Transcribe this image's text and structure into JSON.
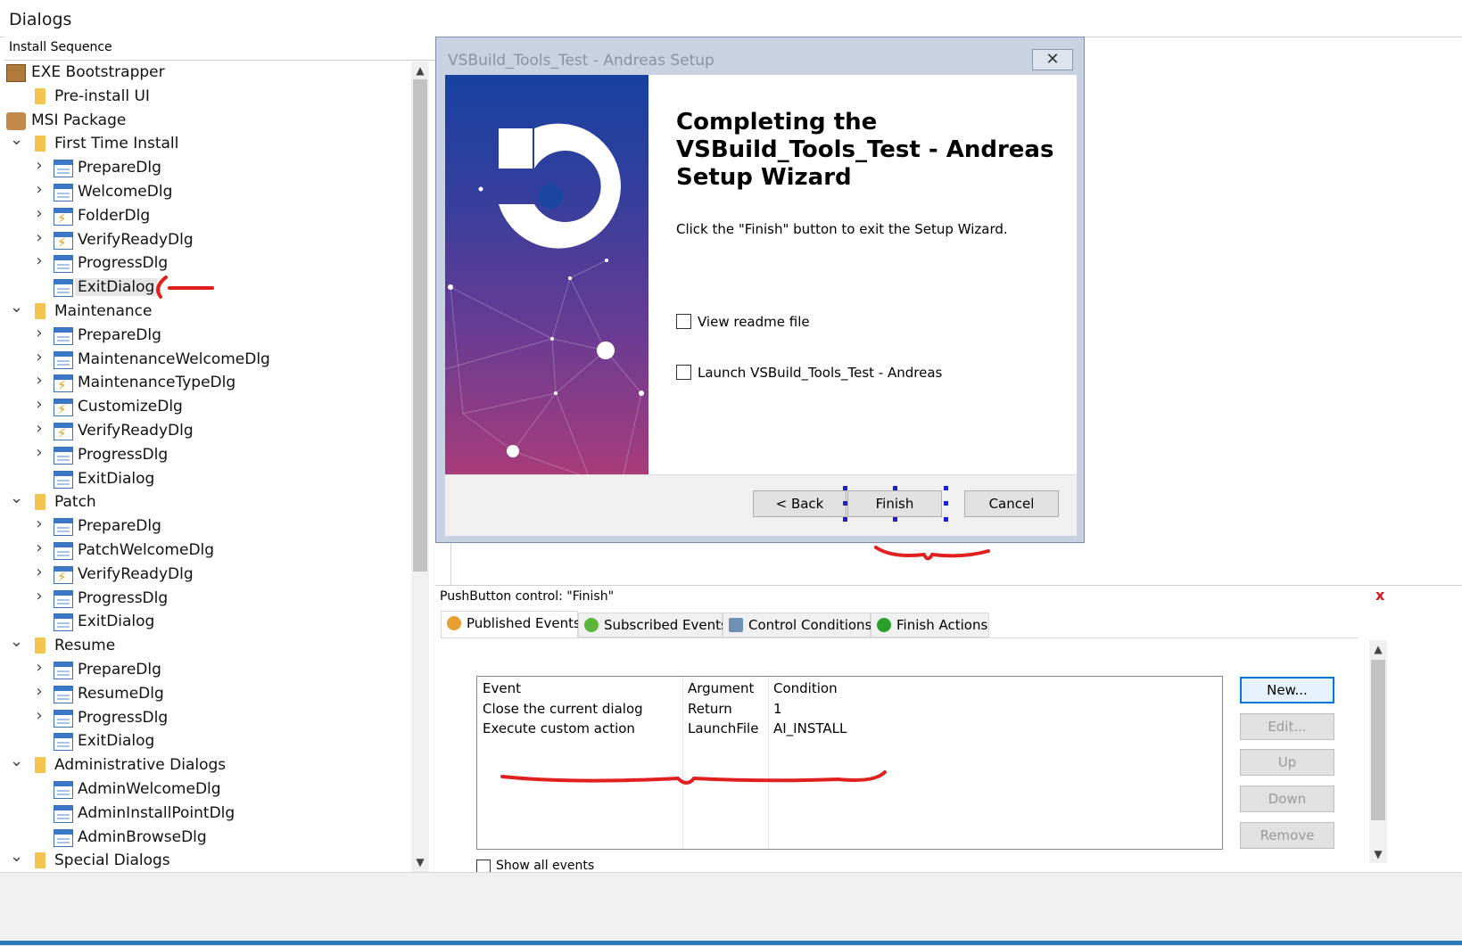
{
  "header": {
    "title": "Dialogs"
  },
  "tree": {
    "heading": "Install Sequence",
    "items": [
      {
        "label": "EXE Bootstrapper",
        "level": 0,
        "icon": "box-icon",
        "chevron": "none"
      },
      {
        "label": "Pre-install UI",
        "level": 1,
        "icon": "folder-icon",
        "chevron": "none"
      },
      {
        "label": "MSI Package",
        "level": 0,
        "icon": "msi-package-icon",
        "chevron": "none"
      },
      {
        "label": "First Time Install",
        "level": 1,
        "icon": "folder-icon",
        "chevron": "down"
      },
      {
        "label": "PrepareDlg",
        "level": 2,
        "icon": "dialog-icon",
        "chevron": "right"
      },
      {
        "label": "WelcomeDlg",
        "level": 2,
        "icon": "dialog-icon",
        "chevron": "right"
      },
      {
        "label": "FolderDlg",
        "level": 2,
        "icon": "dialog-warning-icon",
        "chevron": "right"
      },
      {
        "label": "VerifyReadyDlg",
        "level": 2,
        "icon": "dialog-warning-icon",
        "chevron": "right"
      },
      {
        "label": "ProgressDlg",
        "level": 2,
        "icon": "dialog-icon",
        "chevron": "right"
      },
      {
        "label": "ExitDialog",
        "level": 2,
        "icon": "dialog-icon",
        "chevron": "none",
        "selected": true
      },
      {
        "label": "Maintenance",
        "level": 1,
        "icon": "folder-icon",
        "chevron": "down"
      },
      {
        "label": "PrepareDlg",
        "level": 2,
        "icon": "dialog-icon",
        "chevron": "right"
      },
      {
        "label": "MaintenanceWelcomeDlg",
        "level": 2,
        "icon": "dialog-icon",
        "chevron": "right"
      },
      {
        "label": "MaintenanceTypeDlg",
        "level": 2,
        "icon": "dialog-warning-icon",
        "chevron": "right"
      },
      {
        "label": "CustomizeDlg",
        "level": 2,
        "icon": "dialog-warning-icon",
        "chevron": "right"
      },
      {
        "label": "VerifyReadyDlg",
        "level": 2,
        "icon": "dialog-warning-icon",
        "chevron": "right"
      },
      {
        "label": "ProgressDlg",
        "level": 2,
        "icon": "dialog-icon",
        "chevron": "right"
      },
      {
        "label": "ExitDialog",
        "level": 2,
        "icon": "dialog-icon",
        "chevron": "none"
      },
      {
        "label": "Patch",
        "level": 1,
        "icon": "folder-icon",
        "chevron": "down"
      },
      {
        "label": "PrepareDlg",
        "level": 2,
        "icon": "dialog-icon",
        "chevron": "right"
      },
      {
        "label": "PatchWelcomeDlg",
        "level": 2,
        "icon": "dialog-icon",
        "chevron": "right"
      },
      {
        "label": "VerifyReadyDlg",
        "level": 2,
        "icon": "dialog-warning-icon",
        "chevron": "right"
      },
      {
        "label": "ProgressDlg",
        "level": 2,
        "icon": "dialog-icon",
        "chevron": "right"
      },
      {
        "label": "ExitDialog",
        "level": 2,
        "icon": "dialog-icon",
        "chevron": "none"
      },
      {
        "label": "Resume",
        "level": 1,
        "icon": "folder-icon",
        "chevron": "down"
      },
      {
        "label": "PrepareDlg",
        "level": 2,
        "icon": "dialog-icon",
        "chevron": "right"
      },
      {
        "label": "ResumeDlg",
        "level": 2,
        "icon": "dialog-icon",
        "chevron": "right"
      },
      {
        "label": "ProgressDlg",
        "level": 2,
        "icon": "dialog-icon",
        "chevron": "right"
      },
      {
        "label": "ExitDialog",
        "level": 2,
        "icon": "dialog-icon",
        "chevron": "none"
      },
      {
        "label": "Administrative Dialogs",
        "level": 1,
        "icon": "folder-icon",
        "chevron": "down"
      },
      {
        "label": "AdminWelcomeDlg",
        "level": 2,
        "icon": "dialog-icon",
        "chevron": "none"
      },
      {
        "label": "AdminInstallPointDlg",
        "level": 2,
        "icon": "dialog-icon",
        "chevron": "none"
      },
      {
        "label": "AdminBrowseDlg",
        "level": 2,
        "icon": "dialog-icon",
        "chevron": "none"
      },
      {
        "label": "Special Dialogs",
        "level": 1,
        "icon": "folder-icon",
        "chevron": "down"
      }
    ]
  },
  "dialog": {
    "title": "VSBuild_Tools_Test - Andreas Setup",
    "close_glyph": "✕",
    "heading": "Completing the VSBuild_Tools_Test - Andreas Setup Wizard",
    "body": "Click the \"Finish\" button to exit the Setup Wizard.",
    "checkbox_readme": "View readme file",
    "checkbox_launch": "Launch VSBuild_Tools_Test - Andreas",
    "back_label": "< Back",
    "finish_label": "Finish",
    "cancel_label": "Cancel"
  },
  "props": {
    "title": "PushButton control: \"Finish\"",
    "close_glyph": "x",
    "tabs": [
      {
        "label": "Published Events",
        "active": true,
        "icon": "published-events-icon",
        "color": "#e8a030"
      },
      {
        "label": "Subscribed Events",
        "active": false,
        "icon": "subscribed-events-icon",
        "color": "#5bb53a"
      },
      {
        "label": "Control Conditions",
        "active": false,
        "icon": "control-conditions-icon",
        "color": "#6f8fb5"
      },
      {
        "label": "Finish Actions",
        "active": false,
        "icon": "finish-actions-icon",
        "color": "#2aa02a"
      }
    ],
    "columns": [
      "Event",
      "Argument",
      "Condition"
    ],
    "rows": [
      [
        "Close the current dialog",
        "Return",
        "1"
      ],
      [
        "Execute custom action",
        "LaunchFile",
        "AI_INSTALL"
      ]
    ],
    "buttons": {
      "new": "New...",
      "edit": "Edit...",
      "up": "Up",
      "down": "Down",
      "remove": "Remove"
    },
    "show_all": "Show all events"
  },
  "colors": {
    "accent": "#0078d7",
    "annotation_red": "#e0201e",
    "selection_handle": "#1f1fc8"
  }
}
